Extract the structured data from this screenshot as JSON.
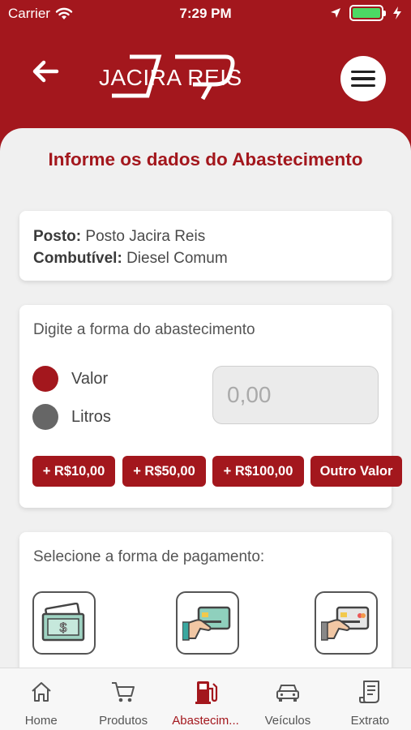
{
  "status_bar": {
    "carrier": "Carrier",
    "time": "7:29 PM"
  },
  "header": {
    "logo_text": "JACIRA REIS"
  },
  "page_title": "Informe os dados do Abastecimento",
  "info": {
    "posto_label": "Posto:",
    "posto_value": "Posto Jacira Reis",
    "combustivel_label": "Combutível:",
    "combustivel_value": "Diesel Comum"
  },
  "form": {
    "title": "Digite a forma do abastecimento",
    "options": [
      {
        "label": "Valor",
        "selected": true
      },
      {
        "label": "Litros",
        "selected": false
      }
    ],
    "input_placeholder": "0,00",
    "quick_amounts": [
      "+ R$10,00",
      "+ R$50,00",
      "+ R$100,00",
      "Outro Valor"
    ]
  },
  "payment": {
    "title": "Selecione a forma de pagamento:",
    "options": [
      "cash-icon",
      "card-payment-icon",
      "card-payment-icon"
    ]
  },
  "tabs": [
    {
      "label": "Home",
      "icon": "home-icon",
      "active": false
    },
    {
      "label": "Produtos",
      "icon": "cart-icon",
      "active": false
    },
    {
      "label": "Abastecim...",
      "icon": "fuel-pump-icon",
      "active": true
    },
    {
      "label": "Veículos",
      "icon": "car-icon",
      "active": false
    },
    {
      "label": "Extrato",
      "icon": "receipt-icon",
      "active": false
    }
  ],
  "colors": {
    "brand_red": "#a3171d",
    "radio_off": "#666666",
    "battery_green": "#4cd964"
  }
}
